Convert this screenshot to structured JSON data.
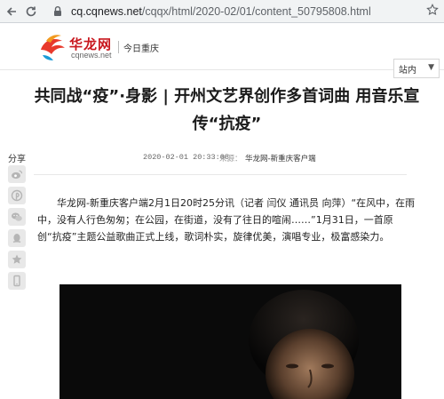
{
  "browser": {
    "url_domain": "cq.cqnews.net",
    "url_path": "/cqqx/html/2020-02/01/content_50795808.html",
    "icons": [
      "back-icon",
      "reload-icon",
      "lock-icon",
      "star-icon"
    ]
  },
  "site": {
    "brand_name": "华龙网",
    "brand_domain": "cqnews.net",
    "channel": "今日重庆",
    "search_scope": "站内",
    "brand_color": "#c8161d"
  },
  "article": {
    "title": "共同战“疫”·身影 | 开州文艺界创作多首词曲 用音乐宣传“抗疫”",
    "time": "2020-02-01 20:33:08",
    "source_label": "来源：",
    "source": "华龙网-新重庆客户端",
    "body": "华龙网-新重庆客户端2月1日20时25分讯（记者 闫仪 通讯员 向萍）“在风中，在雨中，没有人行色匆匆；在公园，在街道，没有了往日的喧闹……”1月31日，一首原创“抗疫”主题公益歌曲正式上线，歌词朴实，旋律优美，演唱专业，极富感染力。"
  },
  "share": {
    "label": "分享",
    "buttons": [
      "weibo-icon",
      "pinterest-icon",
      "wechat-icon",
      "qq-icon",
      "qzone-icon",
      "mobile-icon"
    ]
  }
}
